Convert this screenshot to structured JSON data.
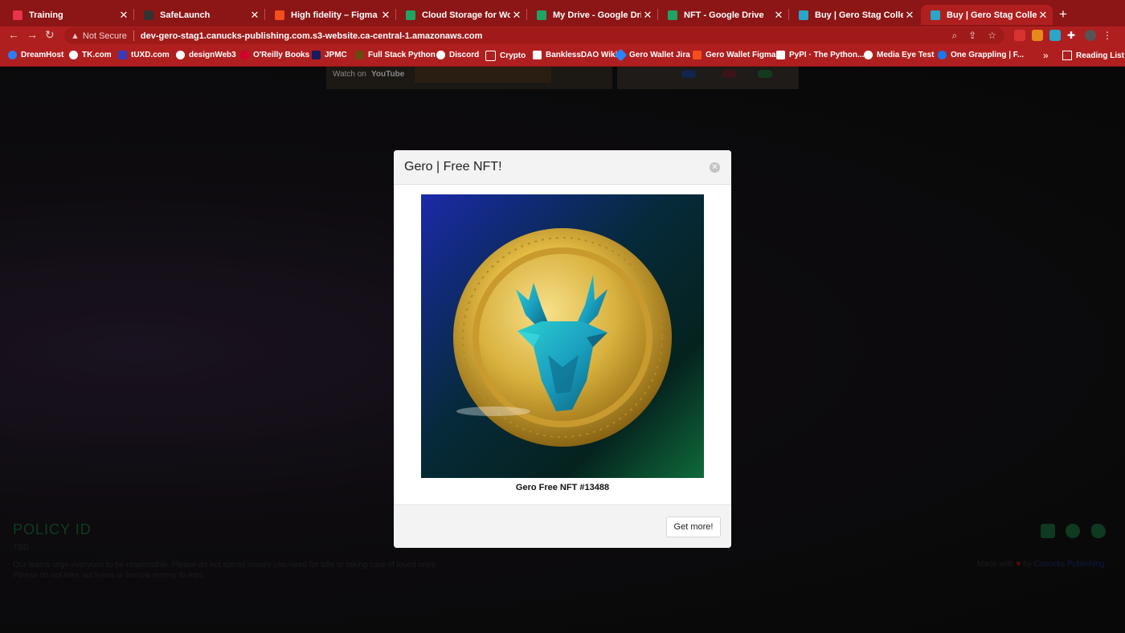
{
  "tabs": [
    {
      "label": "Training",
      "active": false,
      "favicon": "training-icon",
      "color": "#e8334a"
    },
    {
      "label": "SafeLaunch",
      "active": false,
      "favicon": "safelaunch-icon",
      "color": "#333333"
    },
    {
      "label": "High fidelity – Figma",
      "active": false,
      "favicon": "figma-icon",
      "color": "#f24e1e"
    },
    {
      "label": "Cloud Storage for Work and",
      "active": false,
      "favicon": "google-drive-icon",
      "color": "#1fa463"
    },
    {
      "label": "My Drive - Google Drive",
      "active": false,
      "favicon": "google-drive-icon",
      "color": "#1fa463"
    },
    {
      "label": "NFT - Google Drive",
      "active": false,
      "favicon": "google-drive-icon",
      "color": "#1fa463"
    },
    {
      "label": "Buy | Gero Stag Collection",
      "active": false,
      "favicon": "gero-stag-icon",
      "color": "#2aa6c9"
    },
    {
      "label": "Buy | Gero Stag Collection",
      "active": true,
      "favicon": "gero-stag-icon",
      "color": "#2aa6c9"
    }
  ],
  "address_bar": {
    "security": "Not Secure",
    "url": "dev-gero-stag1.canucks-publishing.com.s3-website.ca-central-1.amazonaws.com"
  },
  "bookmarks": [
    {
      "label": "DreamHost",
      "color": "#2e7bf6"
    },
    {
      "label": "TK.com",
      "color": "#ffffff"
    },
    {
      "label": "tUXD.com",
      "color": "#3a3ab8"
    },
    {
      "label": "designWeb3",
      "color": "#ffffff"
    },
    {
      "label": "O'Reilly Books",
      "color": "#d3002d"
    },
    {
      "label": "JPMC",
      "color": "#1a1a5e"
    },
    {
      "label": "Full Stack Python",
      "color": "#6b4a12"
    },
    {
      "label": "Discord",
      "color": "#ffffff"
    },
    {
      "label": "Crypto",
      "color": "#ffffff"
    },
    {
      "label": "BanklessDAO Wiki",
      "color": "#ffffff"
    },
    {
      "label": "Gero Wallet Jira",
      "color": "#2684ff"
    },
    {
      "label": "Gero Wallet Figma",
      "color": "#f24e1e"
    },
    {
      "label": "PyPI · The Python...",
      "color": "#ffffff"
    },
    {
      "label": "Media Eye Test",
      "color": "#ffffff"
    },
    {
      "label": "One Grappling | F...",
      "color": "#1877f2"
    }
  ],
  "reading_list": "Reading List",
  "background_page": {
    "video_watch_on": "Watch on",
    "video_brand": "YouTube",
    "policy_heading": "POLICY ID",
    "policy_value": "TBD",
    "disclaimer_line1": "Our teams urge everyone to be responsible. Please do not spend money you need for bills or taking care of loved ones.",
    "disclaimer_line2": "Please do not take out loans or borrow money to mint.",
    "made_with": "Made with",
    "made_by": "by",
    "made_brand": "Canucks Publishing"
  },
  "modal": {
    "title": "Gero | Free NFT!",
    "nft_caption": "Gero Free NFT #13488",
    "button_label": "Get more!"
  },
  "colors": {
    "chrome_tabbar": "#8c1515",
    "chrome_toolbar": "#b01f1f",
    "coin_gold": "#d8b13a",
    "stag_teal": "#2ab3c8"
  }
}
